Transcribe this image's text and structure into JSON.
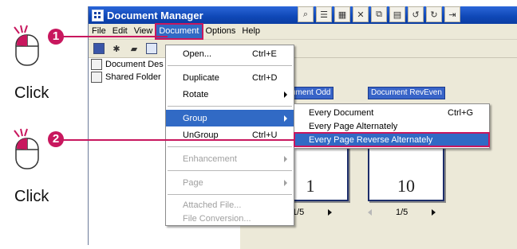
{
  "annotations": {
    "step1": "1",
    "step2": "2",
    "click1": "Click",
    "click2": "Click",
    "accent_color": "#c8175e"
  },
  "window": {
    "title": "Document Manager"
  },
  "menubar": {
    "items": [
      "File",
      "Edit",
      "View",
      "Document",
      "Options",
      "Help"
    ],
    "active": "Document"
  },
  "tree": {
    "items": [
      "Document Des",
      "Shared Folder"
    ]
  },
  "document_menu": {
    "items": [
      {
        "label": "Open...",
        "shortcut": "Ctrl+E"
      },
      {
        "label": "Duplicate",
        "shortcut": "Ctrl+D"
      },
      {
        "label": "Rotate",
        "shortcut": ""
      },
      {
        "label": "Group",
        "shortcut": ""
      },
      {
        "label": "UnGroup",
        "shortcut": "Ctrl+U"
      },
      {
        "label": "Enhancement",
        "shortcut": ""
      },
      {
        "label": "Page",
        "shortcut": ""
      },
      {
        "label": "Attached File...",
        "shortcut": ""
      },
      {
        "label": "File Conversion...",
        "shortcut": ""
      }
    ]
  },
  "group_submenu": {
    "items": [
      {
        "label": "Every Document",
        "shortcut": "Ctrl+G"
      },
      {
        "label": "Every Page Alternately",
        "shortcut": ""
      },
      {
        "label": "Every Page Reverse Alternately",
        "shortcut": ""
      }
    ],
    "highlighted": "Every Page Reverse Alternately"
  },
  "viewer": {
    "doc1_tab": "ument Odd",
    "doc2_tab": "Document RevEven",
    "doc1_page": "1",
    "doc2_page": "10",
    "doc1_pager": "1/5",
    "doc2_pager": "1/5"
  }
}
